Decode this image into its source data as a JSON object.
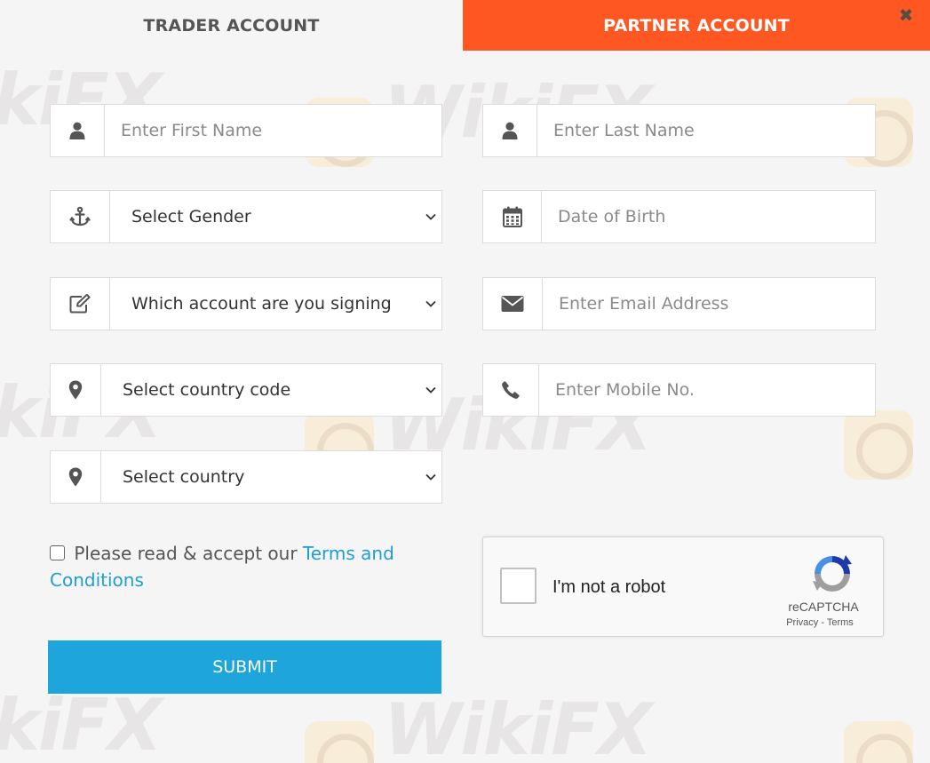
{
  "tabs": {
    "trader": "TRADER ACCOUNT",
    "partner": "PARTNER ACCOUNT"
  },
  "close_glyph": "✖",
  "form": {
    "first_name_placeholder": "Enter First Name",
    "last_name_placeholder": "Enter Last Name",
    "gender_value": "Select Gender",
    "dob_placeholder": "Date of Birth",
    "account_value": "Which account are you signing",
    "email_placeholder": "Enter Email Address",
    "country_code_value": "Select country code",
    "mobile_placeholder": "Enter Mobile No.",
    "country_value": "Select country"
  },
  "terms": {
    "prefix": "Please read & accept our",
    "link": "Terms and Conditions"
  },
  "submit_label": "SUBMIT",
  "captcha": {
    "label": "I'm not a robot",
    "brand": "reCAPTCHA",
    "privacy": "Privacy",
    "separator": " - ",
    "terms": "Terms"
  },
  "watermark": "WikiFX",
  "colors": {
    "partner_tab": "#ff5722",
    "submit": "#1ea5dc",
    "link": "#1e9ed6",
    "background": "#f5f5f5"
  },
  "icons": {
    "first_name": "user-icon",
    "last_name": "user-icon",
    "gender": "anchor-icon",
    "dob": "calendar-icon",
    "account": "edit-icon",
    "email": "envelope-icon",
    "country_code": "map-marker-icon",
    "mobile": "phone-icon",
    "country": "map-marker-icon"
  }
}
